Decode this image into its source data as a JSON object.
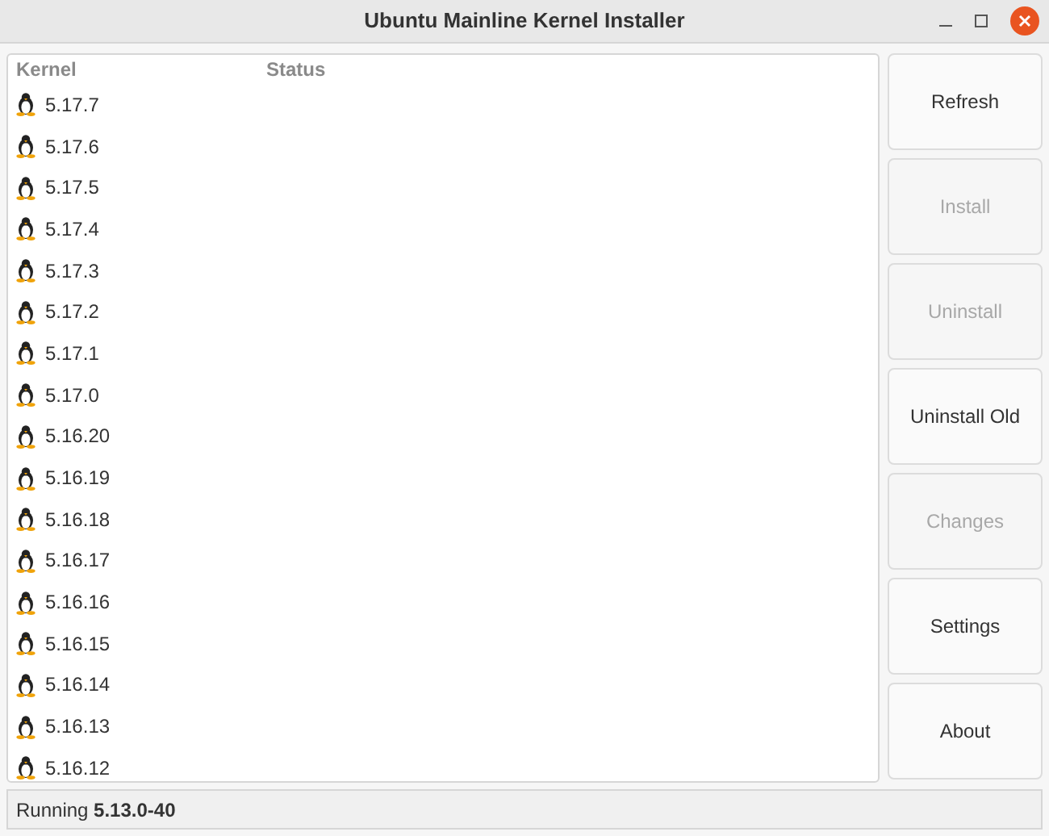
{
  "window": {
    "title": "Ubuntu Mainline Kernel Installer"
  },
  "table": {
    "columns": [
      "Kernel",
      "Status"
    ],
    "rows": [
      {
        "kernel": "5.17.7"
      },
      {
        "kernel": "5.17.6"
      },
      {
        "kernel": "5.17.5"
      },
      {
        "kernel": "5.17.4"
      },
      {
        "kernel": "5.17.3"
      },
      {
        "kernel": "5.17.2"
      },
      {
        "kernel": "5.17.1"
      },
      {
        "kernel": "5.17.0"
      },
      {
        "kernel": "5.16.20"
      },
      {
        "kernel": "5.16.19"
      },
      {
        "kernel": "5.16.18"
      },
      {
        "kernel": "5.16.17"
      },
      {
        "kernel": "5.16.16"
      },
      {
        "kernel": "5.16.15"
      },
      {
        "kernel": "5.16.14"
      },
      {
        "kernel": "5.16.13"
      },
      {
        "kernel": "5.16.12"
      }
    ]
  },
  "buttons": [
    {
      "label": "Refresh",
      "disabled": false
    },
    {
      "label": "Install",
      "disabled": true
    },
    {
      "label": "Uninstall",
      "disabled": true
    },
    {
      "label": "Uninstall Old",
      "disabled": false
    },
    {
      "label": "Changes",
      "disabled": true
    },
    {
      "label": "Settings",
      "disabled": false
    },
    {
      "label": "About",
      "disabled": false
    }
  ],
  "status_bar": "Running **5.13.0-40**"
}
